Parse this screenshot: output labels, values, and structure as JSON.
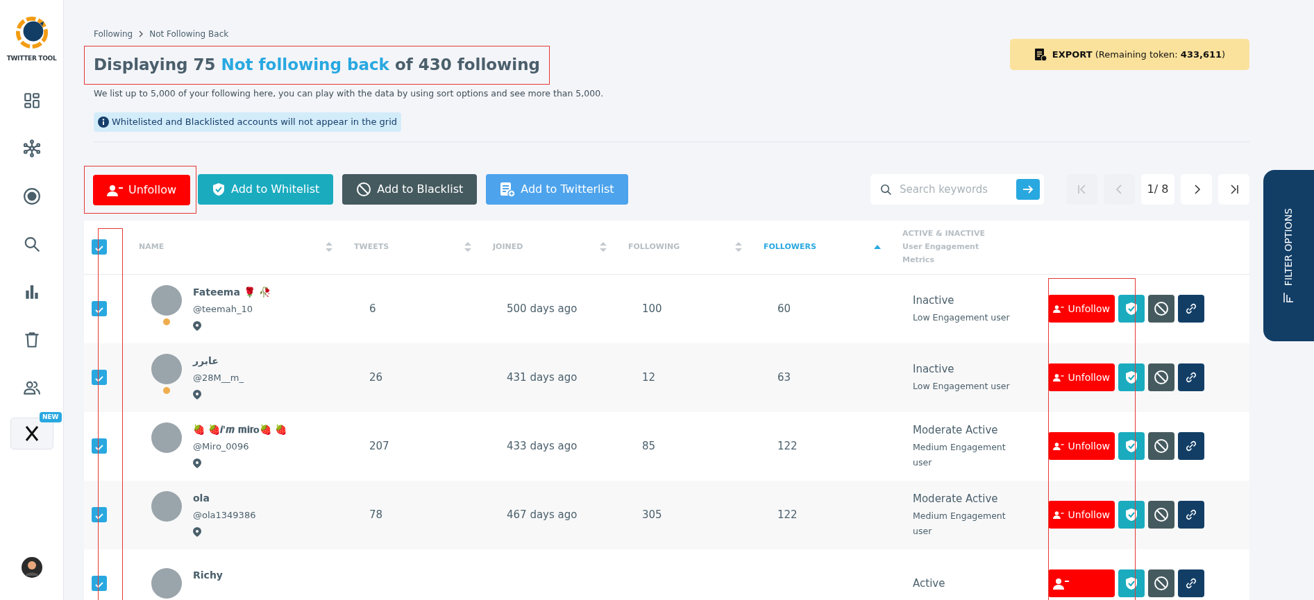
{
  "sidebar": {
    "brand": "TWITTER TOOL",
    "new_badge": "NEW"
  },
  "breadcrumb": [
    "Following",
    "Not Following Back"
  ],
  "title": {
    "prefix": "Displaying 75",
    "highlight": "Not following back",
    "suffix": "of 430 following"
  },
  "description": "We list up to 5,000 of your following here, you can play with the data by using sort options and see more than 5,000.",
  "info_note": "Whitelisted and Blacklisted accounts will not appear in the grid",
  "export_button": "**EXPORT** (Remaining token: **433,611**)",
  "actions": [
    {
      "kind": "unfollow",
      "label": "Unfollow"
    },
    {
      "kind": "whitelist",
      "label": "Add to Whitelist"
    },
    {
      "kind": "blacklist",
      "label": "Add to Blacklist"
    },
    {
      "kind": "twitterlist",
      "label": "Add to Twitterlist"
    }
  ],
  "search": {
    "placeholder": "Search keywords"
  },
  "pagination": {
    "page": "1/ 8",
    "first_disabled": true,
    "prev_disabled": true,
    "next_disabled": false,
    "last_disabled": false
  },
  "table": {
    "select_all_checked": true,
    "columns": [
      {
        "label": "NAME",
        "sortable": true,
        "selected": false
      },
      {
        "label": "TWEETS",
        "sortable": true,
        "selected": false
      },
      {
        "label": "JOINED",
        "sortable": true,
        "selected": false
      },
      {
        "label": "FOLLOWING",
        "sortable": true,
        "selected": false
      },
      {
        "label": "FOLLOWERS",
        "sortable": true,
        "selected": true
      },
      {
        "label": "ACTIVE & INACTIVE",
        "sublabel": "User Engagement Metrics",
        "sortable": false,
        "selected": false
      }
    ],
    "rows": [
      {
        "selected": true,
        "name": "Fateema 🌹 🥀",
        "handle": "@teemah_10",
        "color": "#f0ad4e",
        "tweets": "6",
        "joined": "500 days ago",
        "following": "100",
        "followers": "60",
        "activity": "Inactive",
        "engagement": "Low Engagement user",
        "unfollow": "Unfollow"
      },
      {
        "selected": true,
        "name": "عابرر",
        "handle": "@28M__m_",
        "color": "#f0ad4e",
        "tweets": "26",
        "joined": "431 days ago",
        "following": "12",
        "followers": "63",
        "activity": "Inactive",
        "engagement": "Low Engagement user",
        "unfollow": "Unfollow"
      },
      {
        "selected": true,
        "name": "🍓 🍓𝒊'𝒎 𝐦𝐢𝐫𝐨🍓 🍓",
        "handle": "@Miro_0096",
        "tweets": "207",
        "joined": "433 days ago",
        "following": "85",
        "followers": "122",
        "activity": "Moderate Active",
        "engagement": "Medium Engagement user",
        "unfollow": "Unfollow"
      },
      {
        "selected": true,
        "name": "ola",
        "handle": "@ola1349386",
        "tweets": "78",
        "joined": "467 days ago",
        "following": "305",
        "followers": "122",
        "activity": "Moderate Active",
        "engagement": "Medium Engagement user",
        "unfollow": "Unfollow"
      },
      {
        "selected": true,
        "name": "Richy",
        "activity": "Active"
      }
    ]
  },
  "filter_tab": "FILTER OPTIONS"
}
